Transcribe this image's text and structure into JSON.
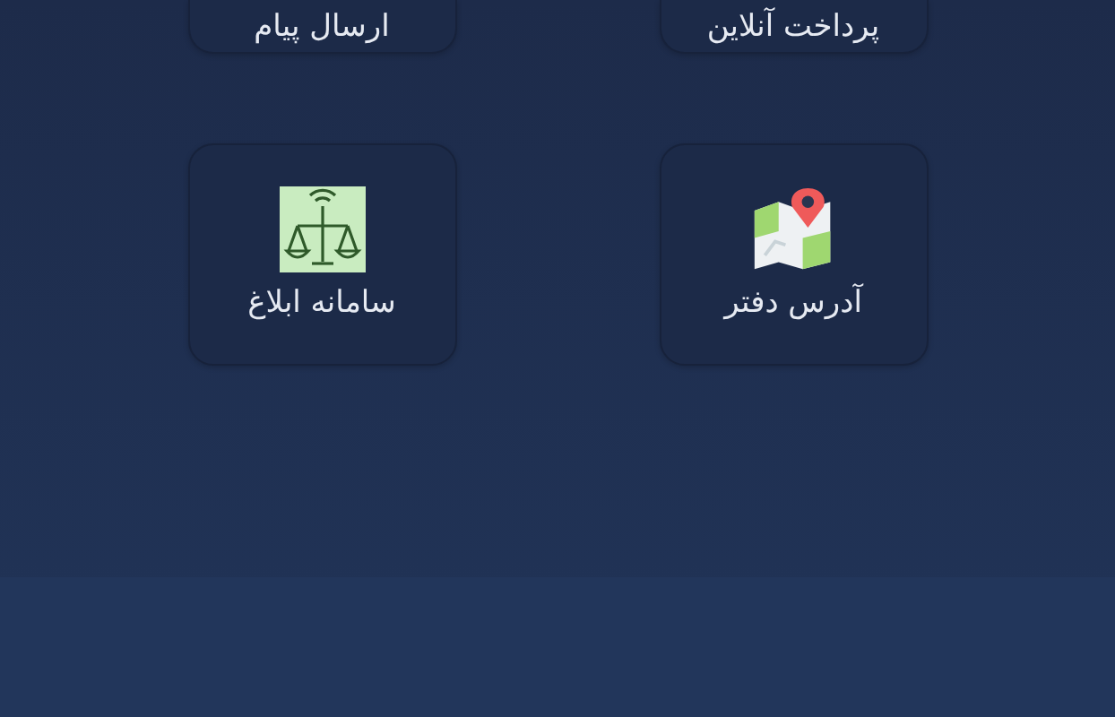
{
  "menu_rows": [
    {
      "items": [
        {
          "label": "پرداخت آنلاین",
          "kind": "none"
        },
        {
          "label": "ارسال پیام",
          "kind": "none"
        }
      ]
    },
    {
      "items": [
        {
          "label": "آدرس دفتر",
          "kind": "map"
        },
        {
          "label": "سامانه ابلاغ",
          "kind": "justice"
        }
      ]
    }
  ]
}
